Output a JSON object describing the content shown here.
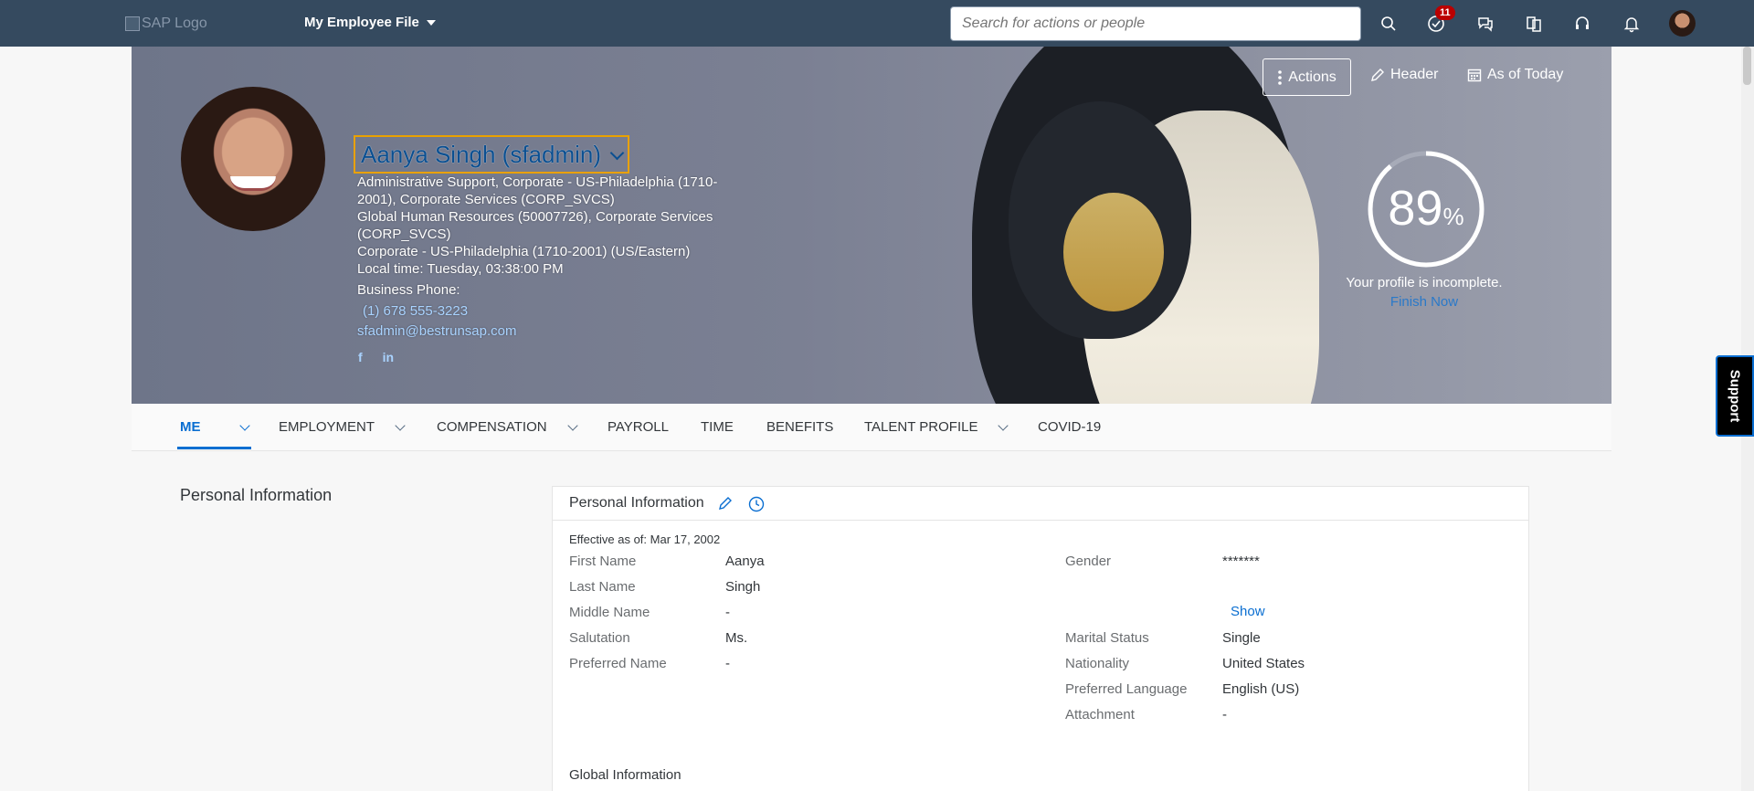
{
  "shell": {
    "logo_alt": "SAP Logo",
    "app_title": "My Employee File",
    "search_placeholder": "Search for actions or people",
    "notifications_count": "11"
  },
  "header": {
    "name": "Aanya Singh (sfadmin)",
    "lines": [
      "Administrative Support, Corporate - US-Philadelphia (1710-2001), Corporate Services (CORP_SVCS)",
      "Global Human Resources (50007726), Corporate Services (CORP_SVCS)",
      "Corporate - US-Philadelphia (1710-2001) (US/Eastern)",
      "Local time: Tuesday, 03:38:00 PM"
    ],
    "phone_label": "Business Phone:",
    "phone": "(1) 678 555-3223",
    "email": "sfadmin@bestrunsap.com",
    "social": [
      "f",
      "in"
    ],
    "buttons": {
      "actions": "Actions",
      "header": "Header",
      "as_of": "As of Today"
    },
    "profile": {
      "percent_value": "89",
      "percent_sign": "%",
      "percent": 89,
      "status": "Your profile is incomplete.",
      "finish": "Finish Now"
    }
  },
  "tabs": [
    {
      "label": "ME",
      "dropdown": true,
      "active": true
    },
    {
      "label": "EMPLOYMENT",
      "dropdown": true
    },
    {
      "label": "COMPENSATION",
      "dropdown": true
    },
    {
      "label": "PAYROLL",
      "dropdown": false
    },
    {
      "label": "TIME",
      "dropdown": false
    },
    {
      "label": "BENEFITS",
      "dropdown": false
    },
    {
      "label": "TALENT PROFILE",
      "dropdown": true
    },
    {
      "label": "COVID-19",
      "dropdown": false
    }
  ],
  "content": {
    "section_title": "Personal Information",
    "card_title": "Personal Information",
    "effective": "Effective as of: Mar 17, 2002",
    "left_fields": [
      {
        "label": "First Name",
        "value": "Aanya"
      },
      {
        "label": "Last Name",
        "value": "Singh"
      },
      {
        "label": "Middle Name",
        "value": "-"
      },
      {
        "label": "Salutation",
        "value": "Ms."
      },
      {
        "label": "Preferred Name",
        "value": "-"
      }
    ],
    "gender": {
      "label": "Gender",
      "value": "*******",
      "show": "Show"
    },
    "right_fields": [
      {
        "label": "Marital Status",
        "value": "Single"
      },
      {
        "label": "Nationality",
        "value": "United States"
      },
      {
        "label": "Preferred Language",
        "value": "English (US)"
      },
      {
        "label": "Attachment",
        "value": "-"
      }
    ],
    "global_title": "Global Information"
  },
  "support_label": "Support",
  "colors": {
    "shell": "#354a5f",
    "accent": "#0a6ed1",
    "highlight": "#e9a100"
  }
}
